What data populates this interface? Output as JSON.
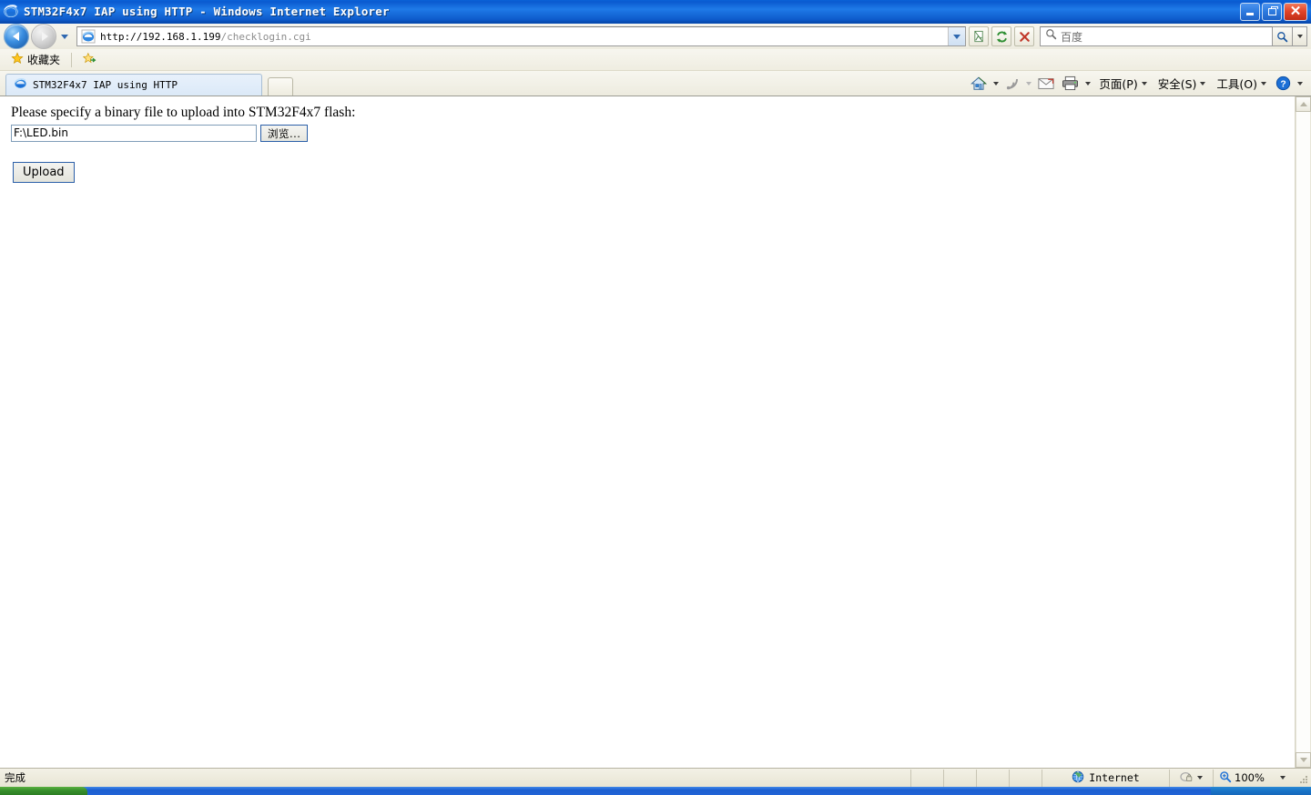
{
  "window": {
    "title": "STM32F4x7 IAP using HTTP - Windows Internet Explorer",
    "minimize_label": "_",
    "restore_label": "❐",
    "close_label": "✕"
  },
  "navigation": {
    "back_label": "Back",
    "forward_label": "Forward",
    "history_label": "Recent Pages"
  },
  "address": {
    "url_host": "http://192.168.1.199",
    "url_path": "/checklogin.cgi",
    "compat_label": "Compatibility View",
    "refresh_label": "Refresh",
    "stop_label": "Stop"
  },
  "search": {
    "value": "百度",
    "go_label": "Search",
    "drop_label": "Search Providers"
  },
  "favorites_bar": {
    "favorites_label": "收藏夹",
    "add_label": "Add to Favorites Bar"
  },
  "tabs": [
    {
      "title": "STM32F4x7 IAP using HTTP"
    }
  ],
  "new_tab_label": "New Tab",
  "command_bar": {
    "home_label": "Home",
    "feeds_label": "Feeds",
    "read_mail_label": "Read Mail",
    "print_label": "Print",
    "menus": [
      {
        "label": "页面(P)"
      },
      {
        "label": "安全(S)"
      },
      {
        "label": "工具(O)"
      }
    ],
    "help_label": "Help"
  },
  "page": {
    "heading": "Please specify a binary file to upload into STM32F4x7 flash:",
    "file_value": "F:\\LED.bin",
    "browse_label": "浏览...",
    "upload_label": "Upload"
  },
  "status_bar": {
    "message": "完成",
    "zone": "Internet",
    "zoom": "100%"
  },
  "colors": {
    "titlebar_blue": "#1f7ae8",
    "close_red": "#e2452a",
    "toolbar_cream": "#efede1",
    "tab_blue": "#dbe9f8",
    "field_border": "#7f9db9",
    "button_border": "#2b5fa8"
  }
}
